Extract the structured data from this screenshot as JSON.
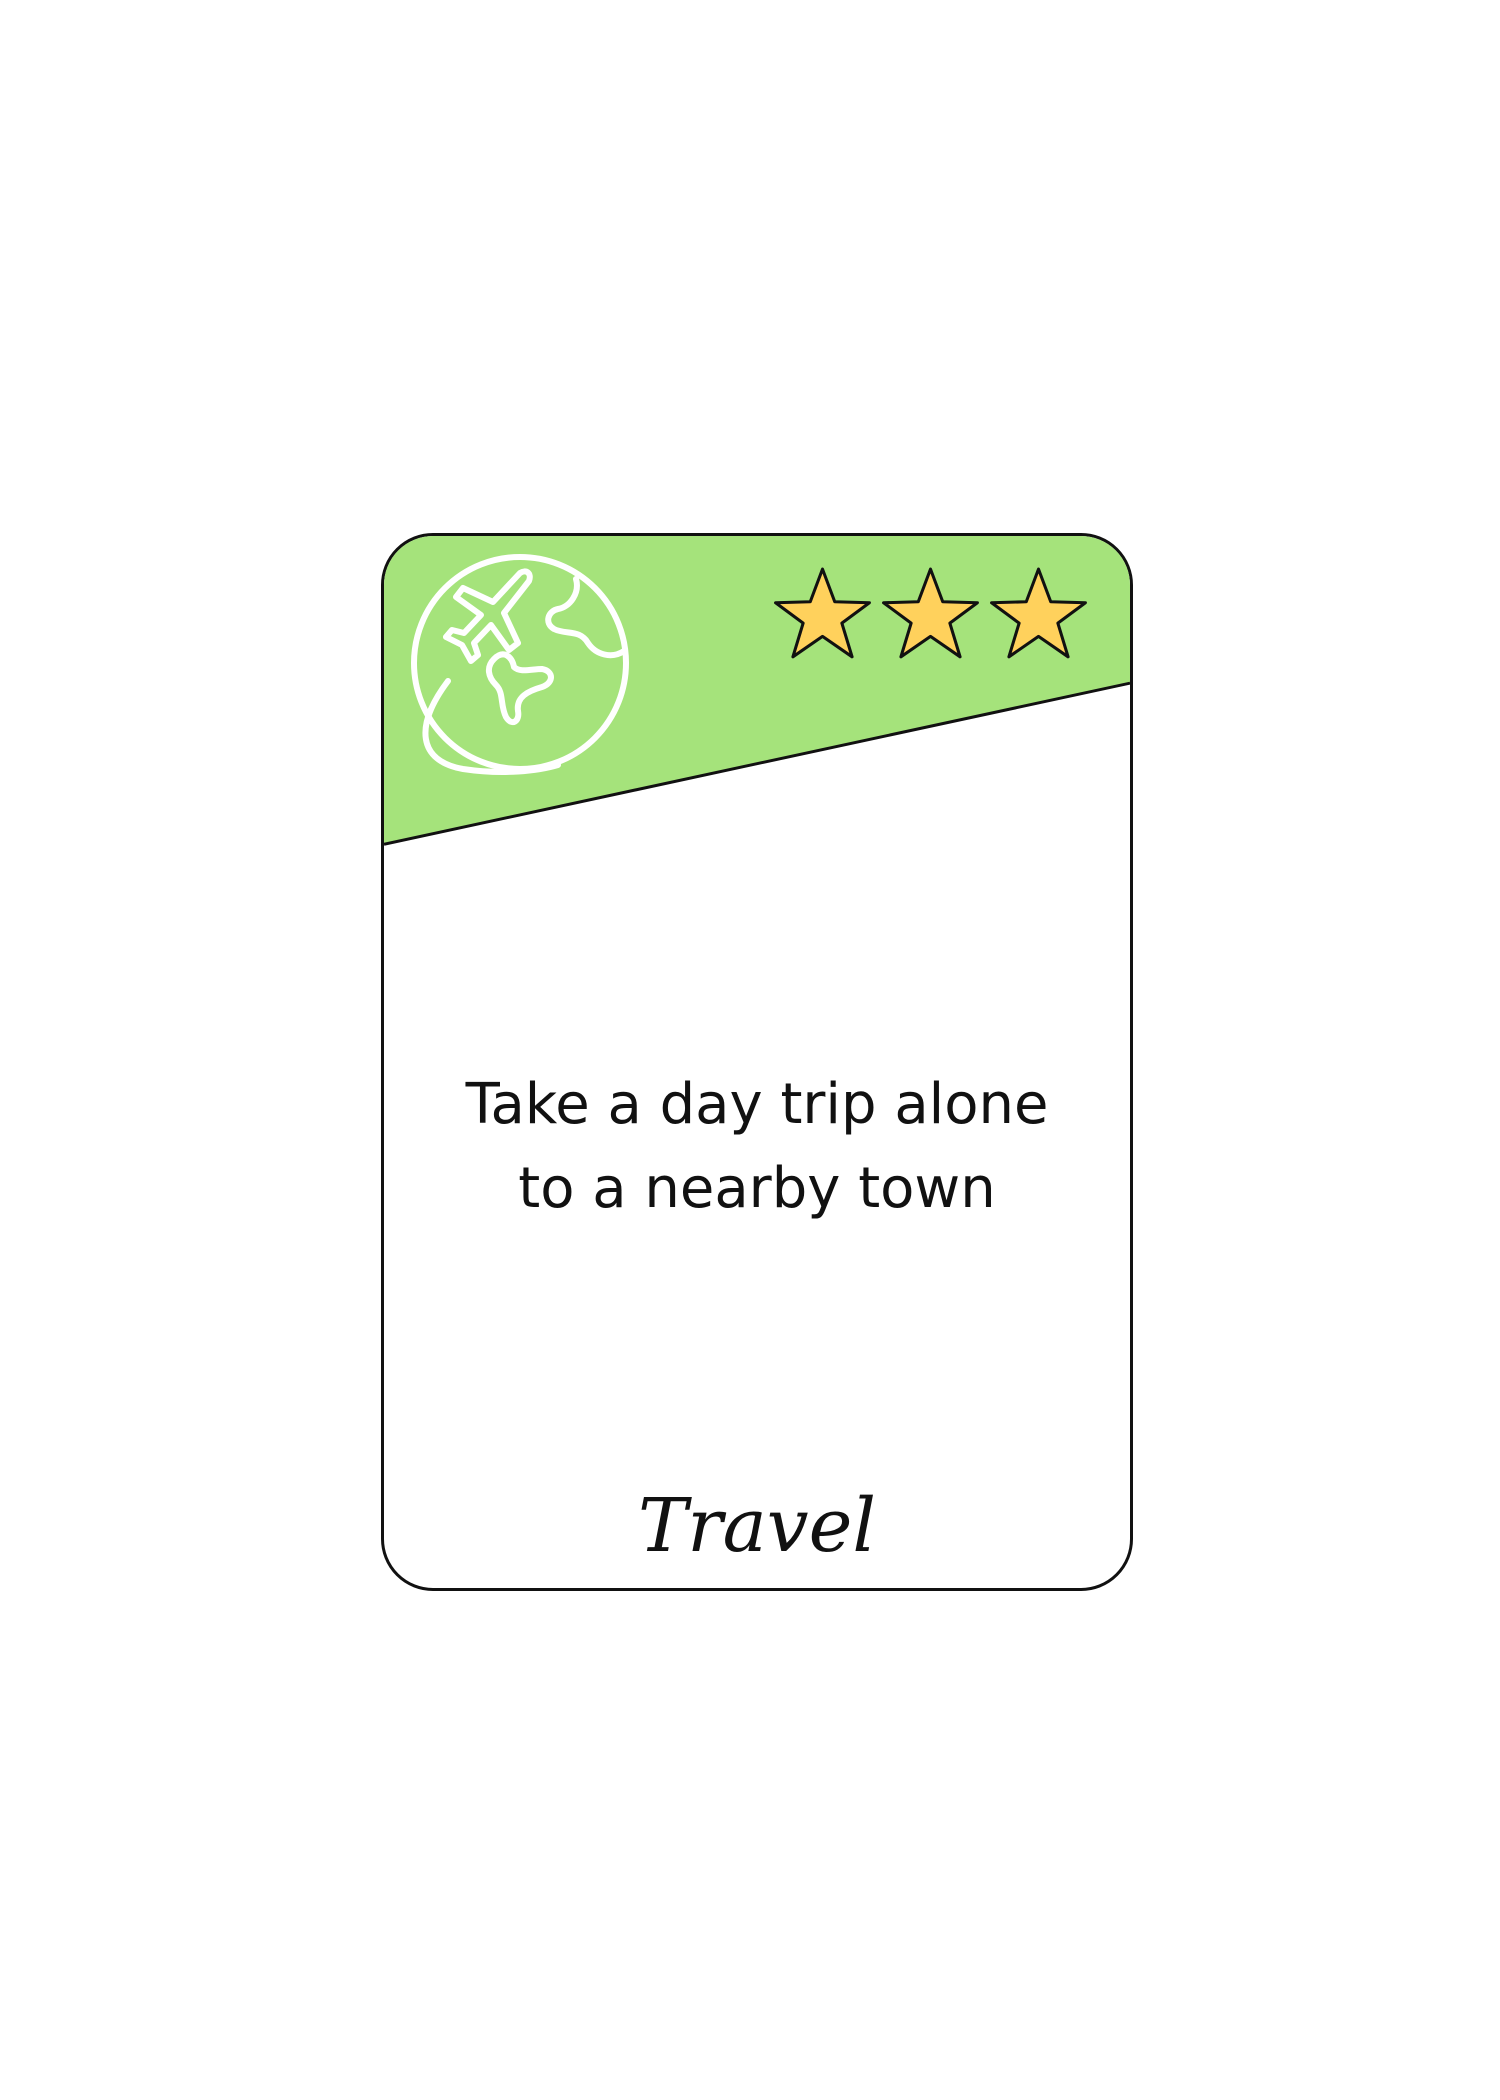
{
  "card": {
    "task_line_1": "Take a day trip alone",
    "task_line_2": "to a nearby town",
    "category": "Travel",
    "icon": "globe-airplane-icon",
    "rating_stars": 3,
    "rating_max": 3
  },
  "colors": {
    "header_green": "#a5e37b",
    "star_fill": "#ffd15c",
    "outline": "#111111",
    "icon_stroke": "#ffffff",
    "background": "#ffffff"
  }
}
